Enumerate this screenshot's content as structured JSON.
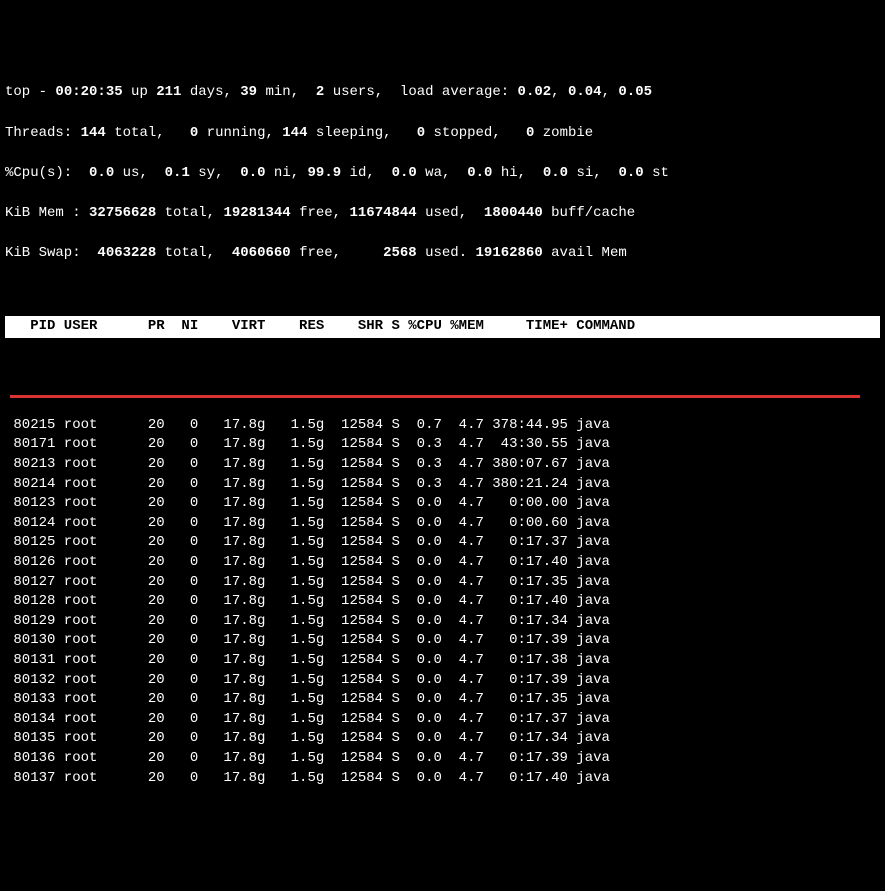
{
  "header": {
    "line1_pre": "top - ",
    "line1_time": "00:20:35",
    "line1_up": " up ",
    "line1_days": "211",
    "line1_days_lbl": " days, ",
    "line1_min": "39",
    "line1_min_lbl": " min,  ",
    "line1_users": "2",
    "line1_users_lbl": " users,  load average: ",
    "line1_la1": "0.02",
    "line1_sep1": ", ",
    "line1_la2": "0.04",
    "line1_sep2": ", ",
    "line1_la3": "0.05",
    "line2_pre": "Threads: ",
    "line2_total": "144",
    "line2_total_lbl": " total,   ",
    "line2_run": "0",
    "line2_run_lbl": " running, ",
    "line2_sleep": "144",
    "line2_sleep_lbl": " sleeping,   ",
    "line2_stop": "0",
    "line2_stop_lbl": " stopped,   ",
    "line2_zomb": "0",
    "line2_zomb_lbl": " zombie",
    "line3_pre": "%Cpu(s):  ",
    "line3_us": "0.0",
    "line3_us_lbl": " us,  ",
    "line3_sy": "0.1",
    "line3_sy_lbl": " sy,  ",
    "line3_ni": "0.0",
    "line3_ni_lbl": " ni, ",
    "line3_id": "99.9",
    "line3_id_lbl": " id,  ",
    "line3_wa": "0.0",
    "line3_wa_lbl": " wa,  ",
    "line3_hi": "0.0",
    "line3_hi_lbl": " hi,  ",
    "line3_si": "0.0",
    "line3_si_lbl": " si,  ",
    "line3_st": "0.0",
    "line3_st_lbl": " st",
    "line4_pre": "KiB Mem : ",
    "line4_total": "32756628",
    "line4_total_lbl": " total, ",
    "line4_free": "19281344",
    "line4_free_lbl": " free, ",
    "line4_used": "11674844",
    "line4_used_lbl": " used,  ",
    "line4_buff": "1800440",
    "line4_buff_lbl": " buff/cache",
    "line5_pre": "KiB Swap:  ",
    "line5_total": "4063228",
    "line5_total_lbl": " total,  ",
    "line5_free": "4060660",
    "line5_free_lbl": " free,     ",
    "line5_used": "2568",
    "line5_used_lbl": " used. ",
    "line5_avail": "19162860",
    "line5_avail_lbl": " avail Mem "
  },
  "columns": "   PID USER      PR  NI    VIRT    RES    SHR S %CPU %MEM     TIME+ COMMAND    ",
  "rows": [
    {
      "pid": " 80215",
      "user": "root",
      "pr": "20",
      "ni": "0",
      "virt": "17.8g",
      "res": "1.5g",
      "shr": "12584",
      "s": "S",
      "cpu": "0.7",
      "mem": "4.7",
      "time": "378:44.95",
      "cmd": "java"
    },
    {
      "pid": " 80171",
      "user": "root",
      "pr": "20",
      "ni": "0",
      "virt": "17.8g",
      "res": "1.5g",
      "shr": "12584",
      "s": "S",
      "cpu": "0.3",
      "mem": "4.7",
      "time": " 43:30.55",
      "cmd": "java"
    },
    {
      "pid": " 80213",
      "user": "root",
      "pr": "20",
      "ni": "0",
      "virt": "17.8g",
      "res": "1.5g",
      "shr": "12584",
      "s": "S",
      "cpu": "0.3",
      "mem": "4.7",
      "time": "380:07.67",
      "cmd": "java"
    },
    {
      "pid": " 80214",
      "user": "root",
      "pr": "20",
      "ni": "0",
      "virt": "17.8g",
      "res": "1.5g",
      "shr": "12584",
      "s": "S",
      "cpu": "0.3",
      "mem": "4.7",
      "time": "380:21.24",
      "cmd": "java"
    },
    {
      "pid": " 80123",
      "user": "root",
      "pr": "20",
      "ni": "0",
      "virt": "17.8g",
      "res": "1.5g",
      "shr": "12584",
      "s": "S",
      "cpu": "0.0",
      "mem": "4.7",
      "time": "  0:00.00",
      "cmd": "java"
    },
    {
      "pid": " 80124",
      "user": "root",
      "pr": "20",
      "ni": "0",
      "virt": "17.8g",
      "res": "1.5g",
      "shr": "12584",
      "s": "S",
      "cpu": "0.0",
      "mem": "4.7",
      "time": "  0:00.60",
      "cmd": "java"
    },
    {
      "pid": " 80125",
      "user": "root",
      "pr": "20",
      "ni": "0",
      "virt": "17.8g",
      "res": "1.5g",
      "shr": "12584",
      "s": "S",
      "cpu": "0.0",
      "mem": "4.7",
      "time": "  0:17.37",
      "cmd": "java"
    },
    {
      "pid": " 80126",
      "user": "root",
      "pr": "20",
      "ni": "0",
      "virt": "17.8g",
      "res": "1.5g",
      "shr": "12584",
      "s": "S",
      "cpu": "0.0",
      "mem": "4.7",
      "time": "  0:17.40",
      "cmd": "java"
    },
    {
      "pid": " 80127",
      "user": "root",
      "pr": "20",
      "ni": "0",
      "virt": "17.8g",
      "res": "1.5g",
      "shr": "12584",
      "s": "S",
      "cpu": "0.0",
      "mem": "4.7",
      "time": "  0:17.35",
      "cmd": "java"
    },
    {
      "pid": " 80128",
      "user": "root",
      "pr": "20",
      "ni": "0",
      "virt": "17.8g",
      "res": "1.5g",
      "shr": "12584",
      "s": "S",
      "cpu": "0.0",
      "mem": "4.7",
      "time": "  0:17.40",
      "cmd": "java"
    },
    {
      "pid": " 80129",
      "user": "root",
      "pr": "20",
      "ni": "0",
      "virt": "17.8g",
      "res": "1.5g",
      "shr": "12584",
      "s": "S",
      "cpu": "0.0",
      "mem": "4.7",
      "time": "  0:17.34",
      "cmd": "java"
    },
    {
      "pid": " 80130",
      "user": "root",
      "pr": "20",
      "ni": "0",
      "virt": "17.8g",
      "res": "1.5g",
      "shr": "12584",
      "s": "S",
      "cpu": "0.0",
      "mem": "4.7",
      "time": "  0:17.39",
      "cmd": "java"
    },
    {
      "pid": " 80131",
      "user": "root",
      "pr": "20",
      "ni": "0",
      "virt": "17.8g",
      "res": "1.5g",
      "shr": "12584",
      "s": "S",
      "cpu": "0.0",
      "mem": "4.7",
      "time": "  0:17.38",
      "cmd": "java"
    },
    {
      "pid": " 80132",
      "user": "root",
      "pr": "20",
      "ni": "0",
      "virt": "17.8g",
      "res": "1.5g",
      "shr": "12584",
      "s": "S",
      "cpu": "0.0",
      "mem": "4.7",
      "time": "  0:17.39",
      "cmd": "java"
    },
    {
      "pid": " 80133",
      "user": "root",
      "pr": "20",
      "ni": "0",
      "virt": "17.8g",
      "res": "1.5g",
      "shr": "12584",
      "s": "S",
      "cpu": "0.0",
      "mem": "4.7",
      "time": "  0:17.35",
      "cmd": "java"
    },
    {
      "pid": " 80134",
      "user": "root",
      "pr": "20",
      "ni": "0",
      "virt": "17.8g",
      "res": "1.5g",
      "shr": "12584",
      "s": "S",
      "cpu": "0.0",
      "mem": "4.7",
      "time": "  0:17.37",
      "cmd": "java"
    },
    {
      "pid": " 80135",
      "user": "root",
      "pr": "20",
      "ni": "0",
      "virt": "17.8g",
      "res": "1.5g",
      "shr": "12584",
      "s": "S",
      "cpu": "0.0",
      "mem": "4.7",
      "time": "  0:17.34",
      "cmd": "java"
    },
    {
      "pid": " 80136",
      "user": "root",
      "pr": "20",
      "ni": "0",
      "virt": "17.8g",
      "res": "1.5g",
      "shr": "12584",
      "s": "S",
      "cpu": "0.0",
      "mem": "4.7",
      "time": "  0:17.39",
      "cmd": "java"
    },
    {
      "pid": " 80137",
      "user": "root",
      "pr": "20",
      "ni": "0",
      "virt": "17.8g",
      "res": "1.5g",
      "shr": "12584",
      "s": "S",
      "cpu": "0.0",
      "mem": "4.7",
      "time": "  0:17.40",
      "cmd": "java"
    }
  ]
}
